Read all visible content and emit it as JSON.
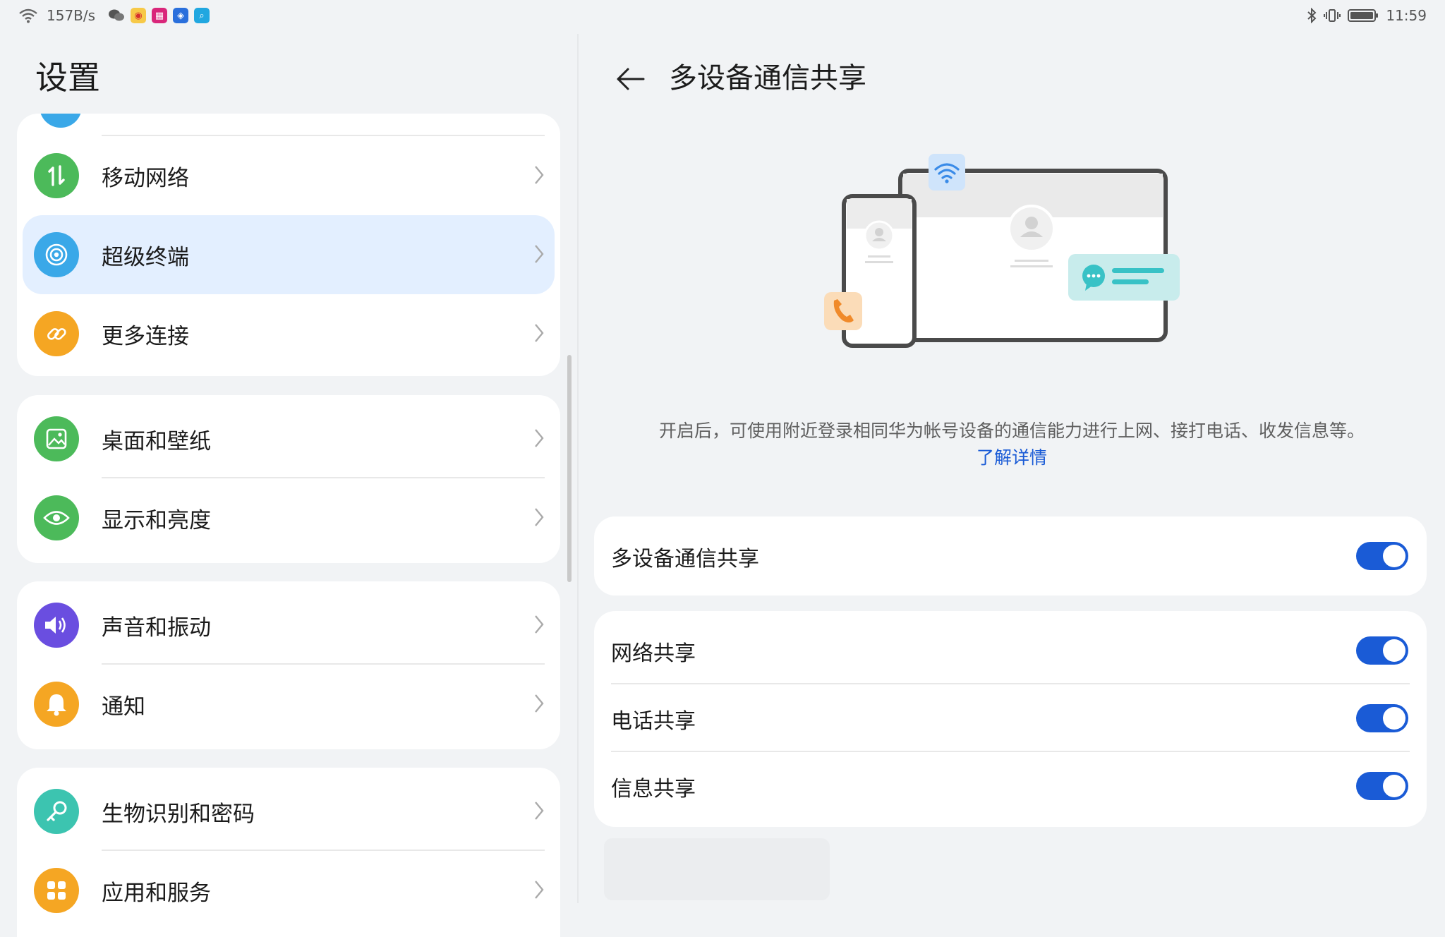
{
  "status_bar": {
    "network_speed": "157B/s",
    "time": "11:59",
    "icons": [
      "wifi-icon",
      "wechat-icon",
      "weibo-icon",
      "app-icon",
      "shield-app-icon",
      "search-app-icon",
      "bluetooth-icon",
      "vibrate-icon",
      "battery-icon"
    ]
  },
  "sidebar": {
    "title": "设置",
    "groups": [
      {
        "items": [
          {
            "label": "移动网络",
            "icon": "mobile-data-icon",
            "color": "#4cba5a"
          },
          {
            "label": "超级终端",
            "icon": "super-device-icon",
            "color": "#3aa8e8",
            "selected": true
          },
          {
            "label": "更多连接",
            "icon": "link-icon",
            "color": "#f5a623"
          }
        ]
      },
      {
        "items": [
          {
            "label": "桌面和壁纸",
            "icon": "wallpaper-icon",
            "color": "#4cba5a"
          },
          {
            "label": "显示和亮度",
            "icon": "eye-icon",
            "color": "#4cba5a"
          }
        ]
      },
      {
        "items": [
          {
            "label": "声音和振动",
            "icon": "speaker-icon",
            "color": "#6a4ee0"
          },
          {
            "label": "通知",
            "icon": "bell-icon",
            "color": "#f5a623"
          }
        ]
      },
      {
        "items": [
          {
            "label": "生物识别和密码",
            "icon": "key-icon",
            "color": "#3cc4b0"
          },
          {
            "label": "应用和服务",
            "icon": "apps-icon",
            "color": "#f5a623"
          }
        ]
      }
    ]
  },
  "detail": {
    "title": "多设备通信共享",
    "description": "开启后，可使用附近登录相同华为帐号设备的通信能力进行上网、接打电话、收发信息等。",
    "learn_more": "了解详情",
    "master_toggle": {
      "label": "多设备通信共享",
      "on": true
    },
    "toggles": [
      {
        "label": "网络共享",
        "on": true
      },
      {
        "label": "电话共享",
        "on": true
      },
      {
        "label": "信息共享",
        "on": true
      }
    ]
  },
  "colors": {
    "accent": "#1a5bd6",
    "selected_bg": "#e3efff",
    "page_bg": "#f1f3f5"
  }
}
